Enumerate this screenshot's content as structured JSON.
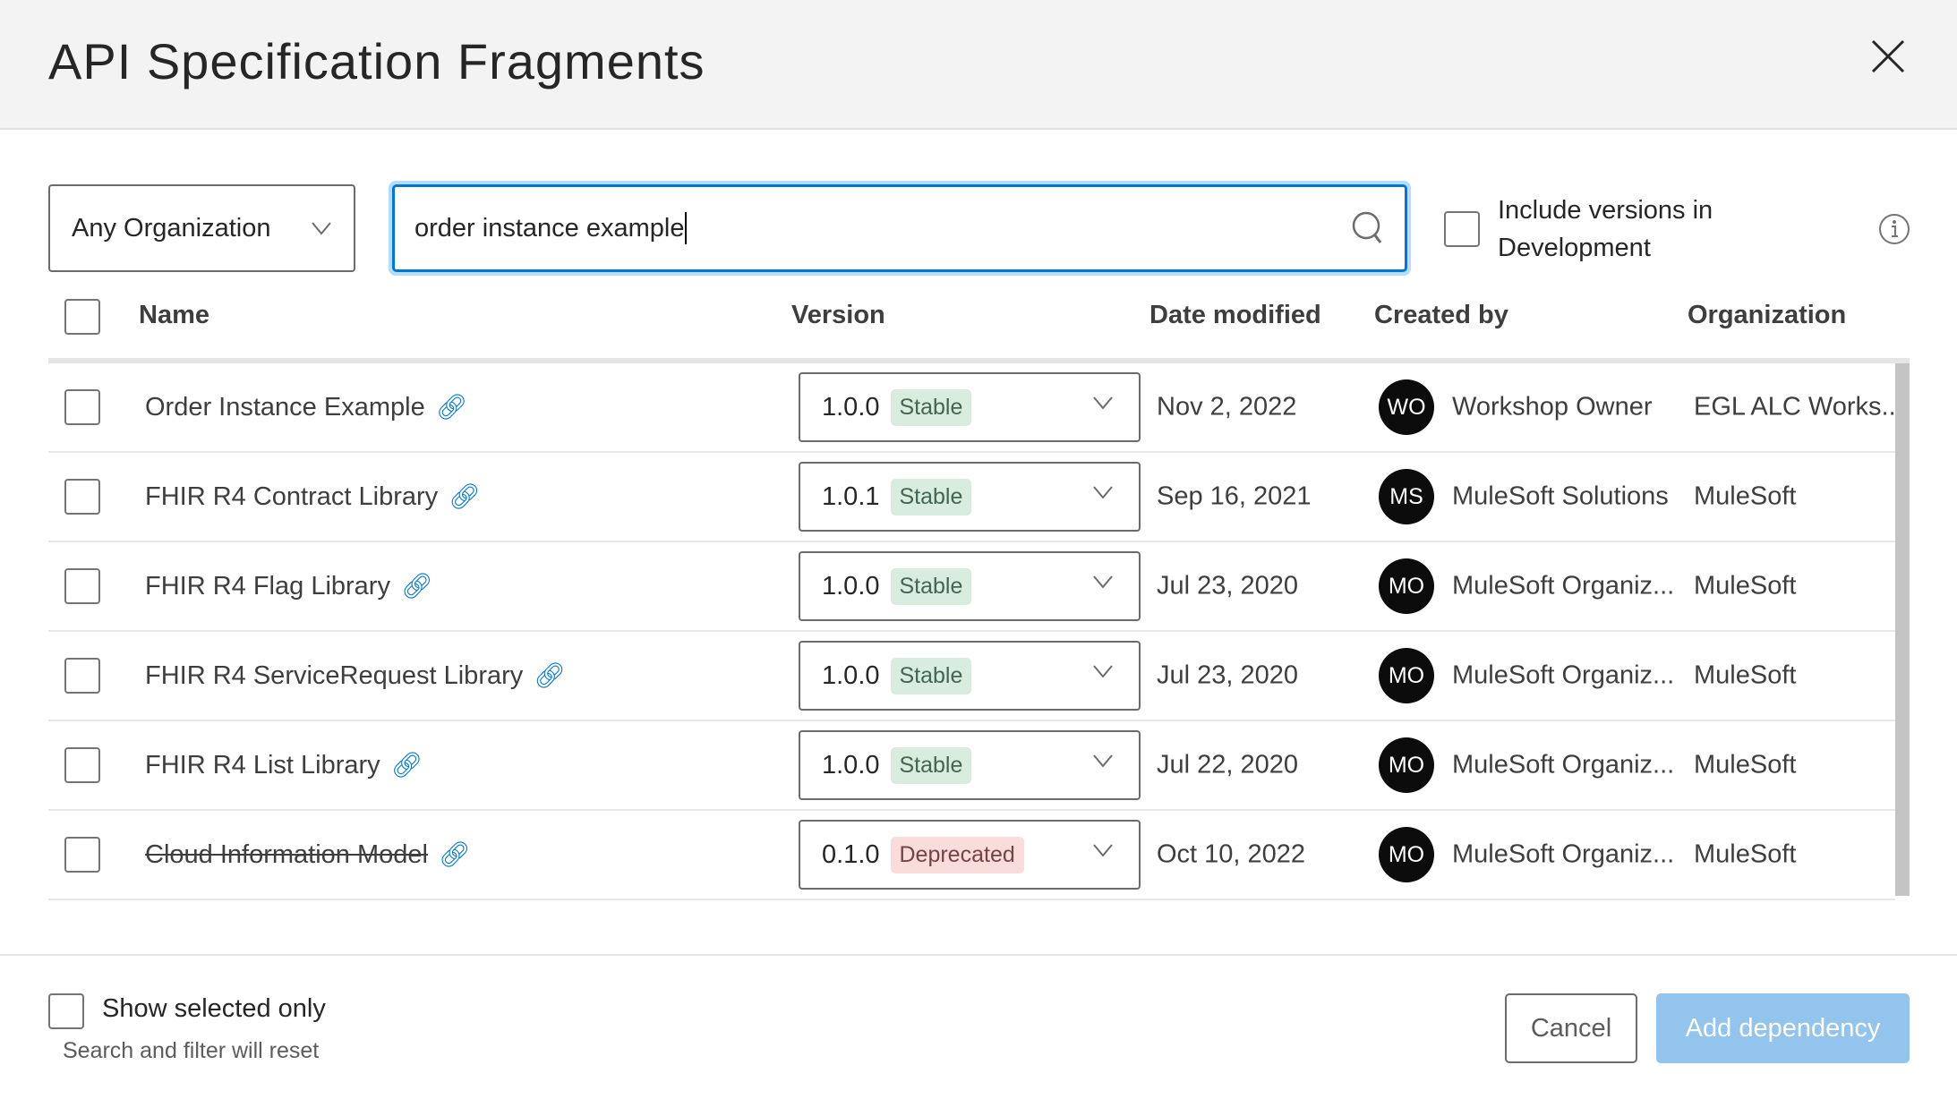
{
  "dialog": {
    "title": "API Specification Fragments"
  },
  "filters": {
    "organization": "Any Organization",
    "search_value": "order instance example",
    "include_dev_label_1": "Include versions in",
    "include_dev_label_2": "Development"
  },
  "table": {
    "headers": {
      "name": "Name",
      "version": "Version",
      "date": "Date modified",
      "created": "Created by",
      "org": "Organization"
    },
    "rows": [
      {
        "name": "Order Instance Example",
        "version": "1.0.0",
        "status": "Stable",
        "date": "Nov 2, 2022",
        "initials": "WO",
        "creator": "Workshop Owner",
        "org": "EGL ALC Works..."
      },
      {
        "name": "FHIR R4 Contract Library",
        "version": "1.0.1",
        "status": "Stable",
        "date": "Sep 16, 2021",
        "initials": "MS",
        "creator": "MuleSoft Solutions",
        "org": "MuleSoft"
      },
      {
        "name": "FHIR R4 Flag Library",
        "version": "1.0.0",
        "status": "Stable",
        "date": "Jul 23, 2020",
        "initials": "MO",
        "creator": "MuleSoft Organiz...",
        "org": "MuleSoft"
      },
      {
        "name": "FHIR R4 ServiceRequest Library",
        "version": "1.0.0",
        "status": "Stable",
        "date": "Jul 23, 2020",
        "initials": "MO",
        "creator": "MuleSoft Organiz...",
        "org": "MuleSoft"
      },
      {
        "name": "FHIR R4 List Library",
        "version": "1.0.0",
        "status": "Stable",
        "date": "Jul 22, 2020",
        "initials": "MO",
        "creator": "MuleSoft Organiz...",
        "org": "MuleSoft"
      },
      {
        "name": "Cloud Information Model",
        "version": "0.1.0",
        "status": "Deprecated",
        "date": "Oct 10, 2022",
        "initials": "MO",
        "creator": "MuleSoft Organiz...",
        "org": "MuleSoft"
      }
    ]
  },
  "footer": {
    "show_selected": "Show selected only",
    "hint": "Search and filter will reset",
    "cancel": "Cancel",
    "add": "Add dependency"
  }
}
